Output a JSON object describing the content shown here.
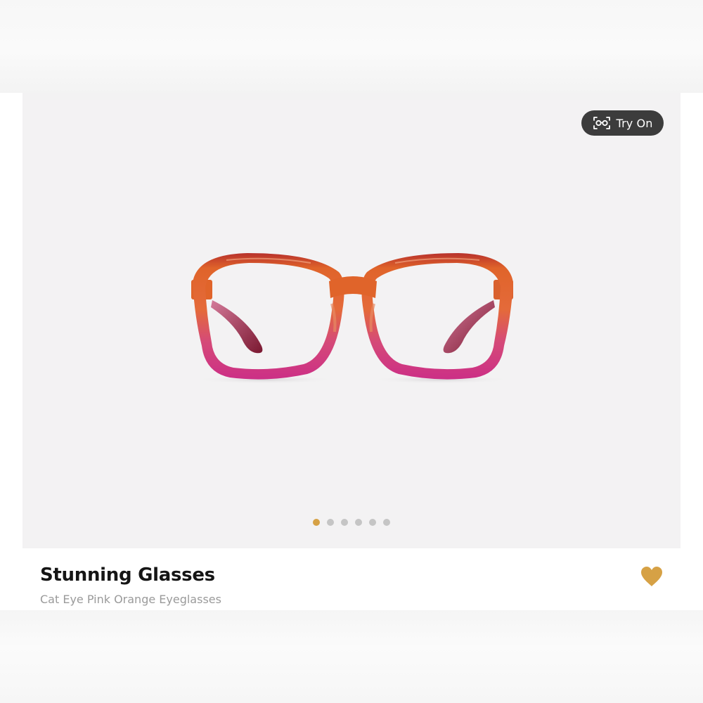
{
  "try_on": {
    "label": "Try On",
    "icon": "face-scan-glasses-icon"
  },
  "carousel": {
    "total": 6,
    "active_index": 0,
    "active_color": "#d6a145",
    "inactive_color": "#c5c5c5"
  },
  "product": {
    "name": "Stunning Glasses",
    "description": "Cat Eye Pink Orange Eyeglasses",
    "image_alt": "Cat eye pink orange eyeglasses frame",
    "frame_colors": [
      "#e0642a",
      "#8e1d35",
      "#d63a8e"
    ],
    "favorite_icon": "heart-icon",
    "favorite_color": "#d6a145"
  }
}
